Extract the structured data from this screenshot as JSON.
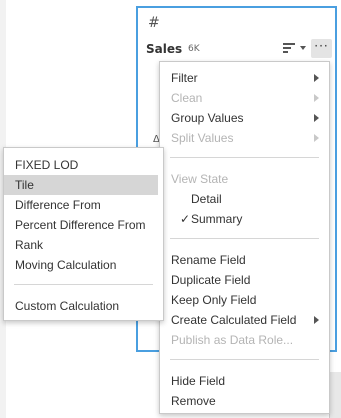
{
  "card": {
    "type_icon": "#",
    "field_name": "Sales",
    "field_count": "6K",
    "more_label": "···",
    "fragment": "Δ"
  },
  "main_menu": {
    "filter": "Filter",
    "clean": "Clean",
    "group_values": "Group Values",
    "split_values": "Split Values",
    "view_state": "View State",
    "detail": "Detail",
    "summary_check": "✓",
    "summary": "Summary",
    "rename_field": "Rename Field",
    "duplicate_field": "Duplicate Field",
    "keep_only_field": "Keep Only Field",
    "create_calculated_field": "Create Calculated Field",
    "publish_as_data_role": "Publish as Data Role...",
    "hide_field": "Hide Field",
    "remove": "Remove"
  },
  "sub_menu": {
    "fixed_lod": "FIXED LOD",
    "tile": "Tile",
    "difference_from": "Difference From",
    "percent_difference_from": "Percent Difference From",
    "rank": "Rank",
    "moving_calculation": "Moving Calculation",
    "custom_calculation": "Custom Calculation"
  },
  "colors": {
    "card_border": "#4a9fe0",
    "disabled_text": "#b4b4b4",
    "selected_bg": "#d6d6d6"
  }
}
